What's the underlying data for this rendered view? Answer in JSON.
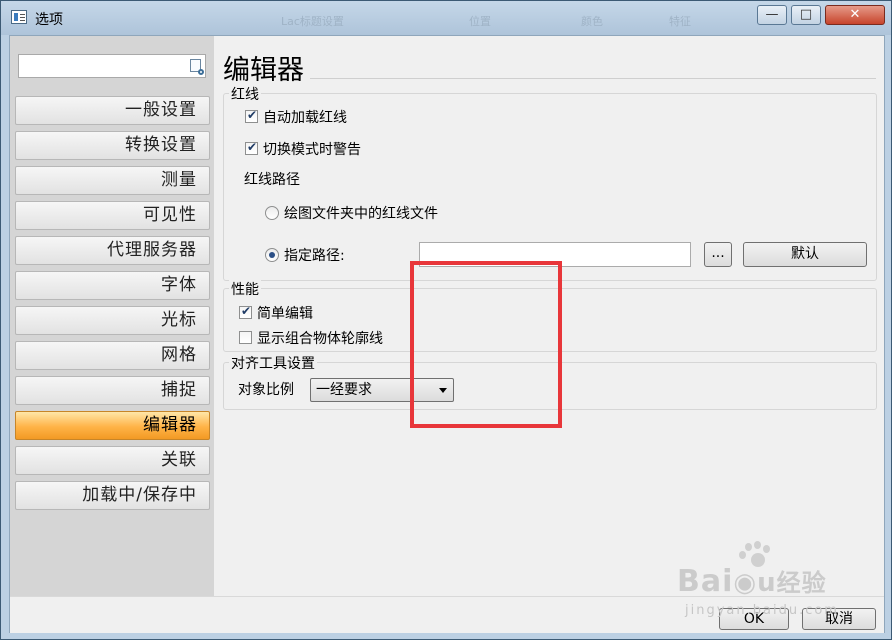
{
  "window": {
    "title": "选项",
    "background_ghost": [
      "Lac标题设置",
      "位置",
      "颜色",
      "特征"
    ],
    "buttons": {
      "minimize": "—",
      "maximize": "□",
      "close": "✕"
    }
  },
  "sidebar": {
    "search_placeholder": "",
    "items": [
      {
        "label": "一般设置"
      },
      {
        "label": "转换设置"
      },
      {
        "label": "测量"
      },
      {
        "label": "可见性"
      },
      {
        "label": "代理服务器"
      },
      {
        "label": "字体"
      },
      {
        "label": "光标"
      },
      {
        "label": "网格"
      },
      {
        "label": "捕捉"
      },
      {
        "label": "编辑器",
        "active": true
      },
      {
        "label": "关联"
      },
      {
        "label": "加载中/保存中"
      }
    ]
  },
  "main": {
    "title": "编辑器",
    "redline": {
      "title": "红线",
      "auto_load": {
        "label": "自动加载红线",
        "checked": true
      },
      "warn_on_switch": {
        "label": "切换模式时警告",
        "checked": true
      },
      "path_title": "红线路径",
      "option_drawing_folder": {
        "label": "绘图文件夹中的红线文件",
        "selected": false
      },
      "option_specified_path": {
        "label": "指定路径:",
        "selected": true
      },
      "path_value": "",
      "browse_label": "...",
      "default_label": "默认"
    },
    "performance": {
      "title": "性能",
      "simple_edit": {
        "label": "简单编辑",
        "checked": true
      },
      "show_group_outline": {
        "label": "显示组合物体轮廓线",
        "checked": false
      }
    },
    "align_tools": {
      "title": "对齐工具设置",
      "object_ratio_label": "对象比例",
      "object_ratio_value": "一经要求"
    }
  },
  "footer": {
    "ok_label": "OK",
    "cancel_label": "取消"
  },
  "watermark": {
    "brand": "Bai",
    "brand2": "经验",
    "url": "jingyan.baidu.com"
  },
  "colors": {
    "active_item": "#ffb347",
    "annotation": "#e8363a",
    "titlebar": "#bcd0e3"
  }
}
